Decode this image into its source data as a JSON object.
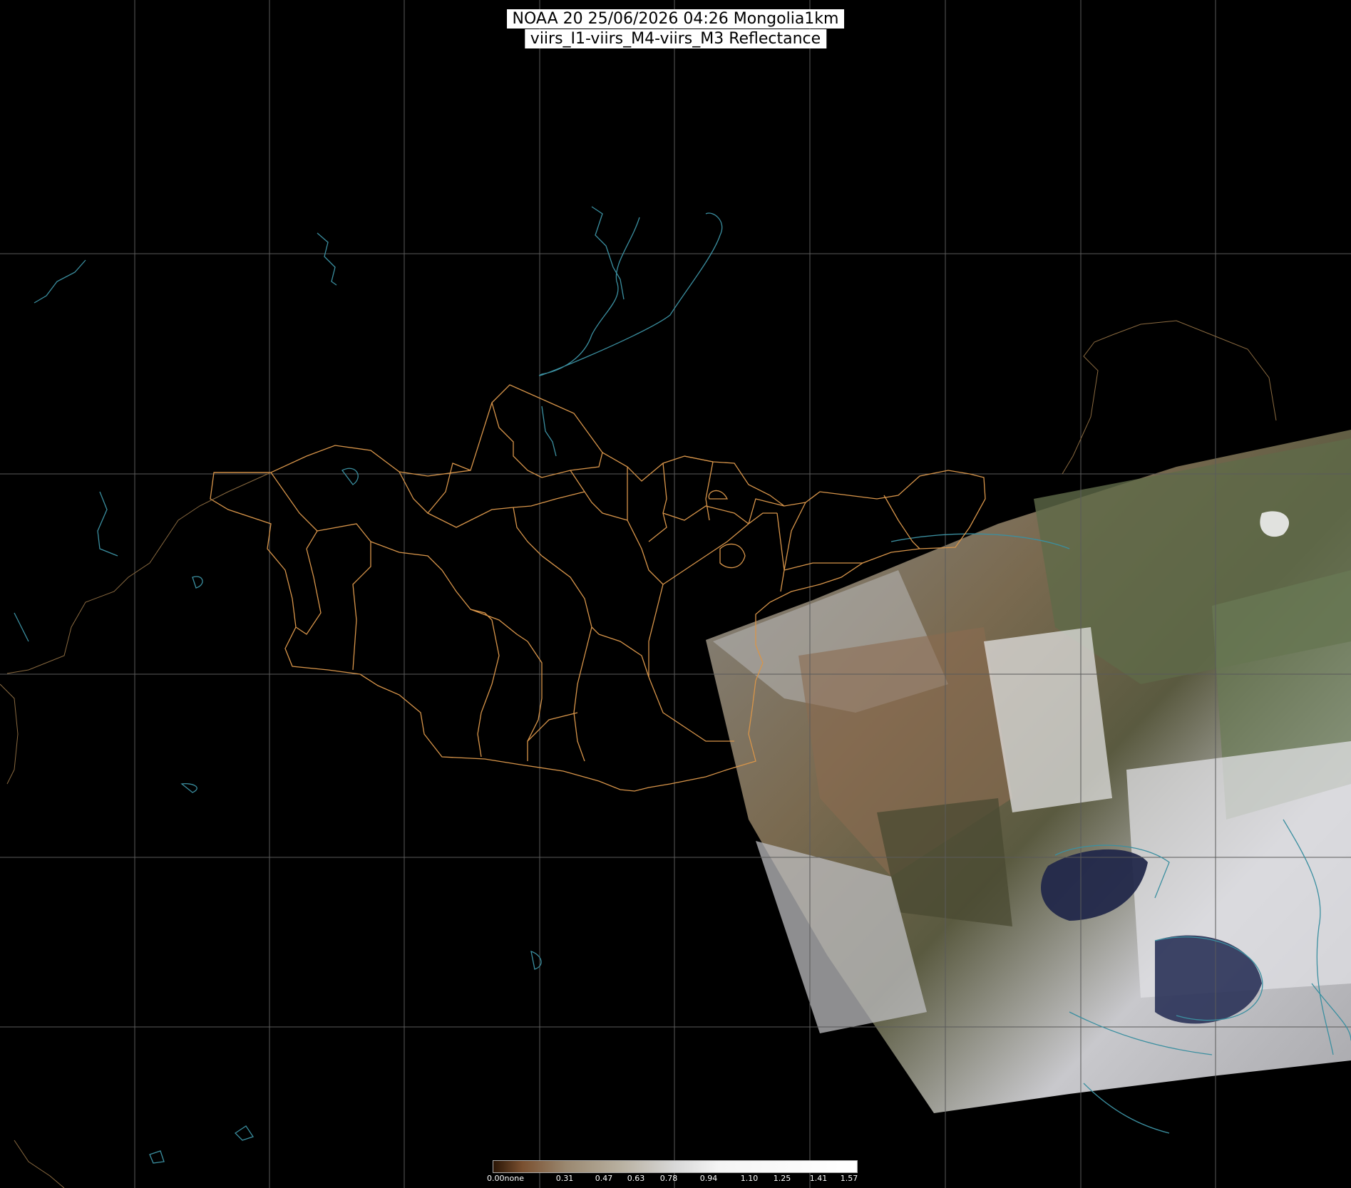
{
  "header": {
    "title_line1": "NOAA 20 25/06/2026 04:26 Mongolia1km",
    "title_line2": "viirs_I1-viirs_M4-viirs_M3 Reflectance"
  },
  "legend": {
    "ticks": [
      "0.00none",
      "0.31",
      "0.47",
      "0.63",
      "0.78",
      "0.94",
      "1.10",
      "1.25",
      "1.41",
      "1.57"
    ]
  },
  "colors": {
    "background": "#000000",
    "grid": "#5a5a5a",
    "borders": "#d8954a",
    "water": "#3b8fa0"
  }
}
